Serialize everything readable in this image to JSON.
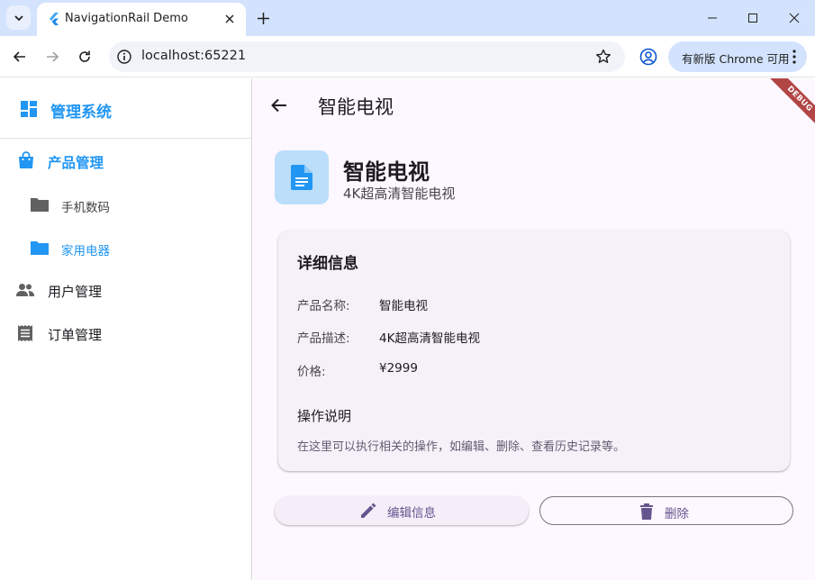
{
  "browser": {
    "tab_title": "NavigationRail Demo",
    "url": "localhost:65221",
    "update_label": "有新版 Chrome 可用"
  },
  "sidebar": {
    "title": "管理系统",
    "items": [
      {
        "label": "产品管理",
        "icon": "shopping-bag-icon",
        "active": true
      },
      {
        "label": "手机数码",
        "icon": "folder-icon",
        "active": false
      },
      {
        "label": "家用电器",
        "icon": "folder-icon",
        "active": true
      },
      {
        "label": "用户管理",
        "icon": "people-icon",
        "active": false
      },
      {
        "label": "订单管理",
        "icon": "receipt-icon",
        "active": false
      }
    ]
  },
  "main": {
    "appbar_title": "智能电视",
    "debug_label": "DEBUG",
    "product_name": "智能电视",
    "product_subtitle": "4K超高清智能电视",
    "card": {
      "title": "详细信息",
      "rows": [
        {
          "label": "产品名称:",
          "value": "智能电视"
        },
        {
          "label": "产品描述:",
          "value": "4K超高清智能电视"
        },
        {
          "label": "价格:",
          "value": "¥2999"
        }
      ],
      "ops_title": "操作说明",
      "ops_text": "在这里可以执行相关的操作，如编辑、删除、查看历史记录等。"
    },
    "edit_label": "编辑信息",
    "delete_label": "删除"
  },
  "colors": {
    "accent": "#2196f3",
    "button_text": "#65558f",
    "content_bg": "#fdf7ff"
  }
}
